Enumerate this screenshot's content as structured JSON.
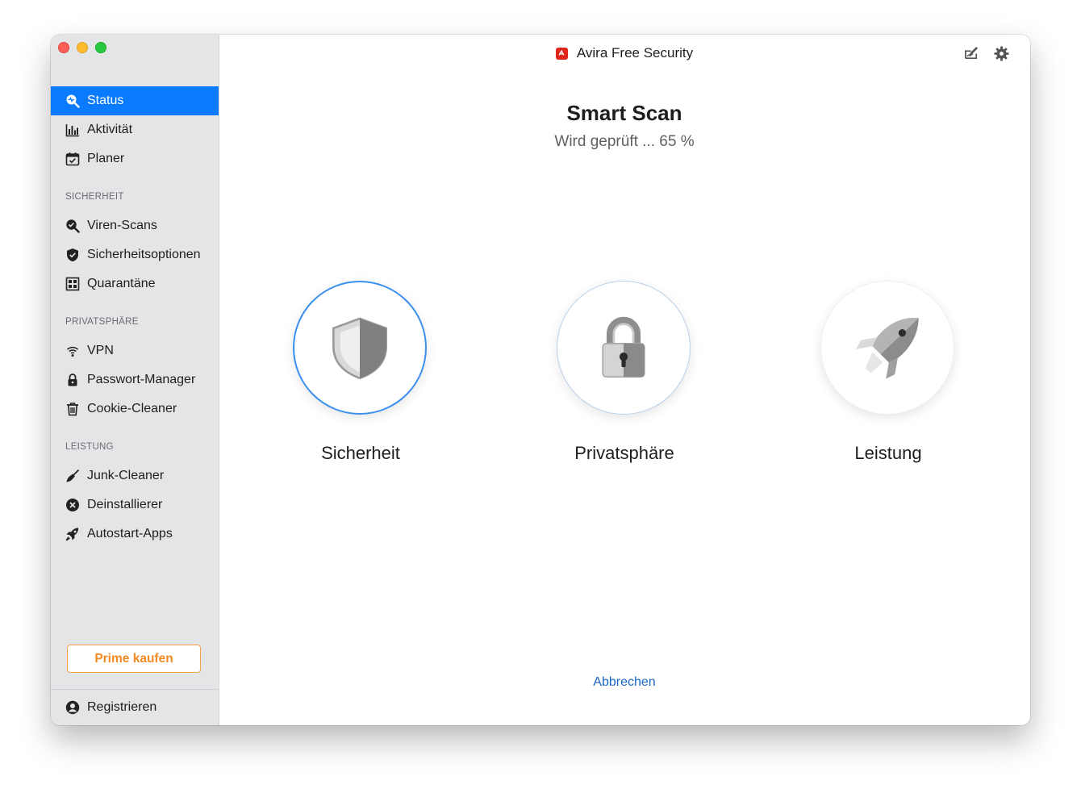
{
  "window": {
    "title": "Avira Free Security"
  },
  "sidebar": {
    "top_items": [
      {
        "label": "Status",
        "icon": "status-search-icon",
        "active": true
      },
      {
        "label": "Aktivität",
        "icon": "bar-chart-icon",
        "active": false
      },
      {
        "label": "Planer",
        "icon": "calendar-check-icon",
        "active": false
      }
    ],
    "sections": [
      {
        "title": "SICHERHEIT",
        "items": [
          {
            "label": "Viren-Scans",
            "icon": "virus-scan-icon"
          },
          {
            "label": "Sicherheitsoptionen",
            "icon": "shield-check-icon"
          },
          {
            "label": "Quarantäne",
            "icon": "quarantine-box-icon"
          }
        ]
      },
      {
        "title": "PRIVATSPHÄRE",
        "items": [
          {
            "label": "VPN",
            "icon": "vpn-wifi-icon"
          },
          {
            "label": "Passwort-Manager",
            "icon": "lock-icon"
          },
          {
            "label": "Cookie-Cleaner",
            "icon": "trash-icon"
          }
        ]
      },
      {
        "title": "LEISTUNG",
        "items": [
          {
            "label": "Junk-Cleaner",
            "icon": "broom-icon"
          },
          {
            "label": "Deinstallierer",
            "icon": "x-circle-icon"
          },
          {
            "label": "Autostart-Apps",
            "icon": "rocket-icon"
          }
        ]
      }
    ],
    "prime_button": "Prime kaufen",
    "register": {
      "label": "Registrieren",
      "icon": "user-circle-icon"
    }
  },
  "main": {
    "scan_title": "Smart Scan",
    "scan_status": "Wird geprüft ... 65 %",
    "progress_percent": 65,
    "features": [
      {
        "label": "Sicherheit",
        "icon": "shield-icon",
        "state": "active"
      },
      {
        "label": "Privatsphäre",
        "icon": "padlock-icon",
        "state": "partial"
      },
      {
        "label": "Leistung",
        "icon": "rocket-icon",
        "state": "pending"
      }
    ],
    "cancel": "Abbrechen"
  },
  "toolbar": {
    "icons": [
      "feedback-icon",
      "gear-icon"
    ]
  },
  "colors": {
    "accent": "#0a7bfe",
    "prime": "#f28b22",
    "link": "#1b66c9",
    "brand": "#e0251b"
  }
}
